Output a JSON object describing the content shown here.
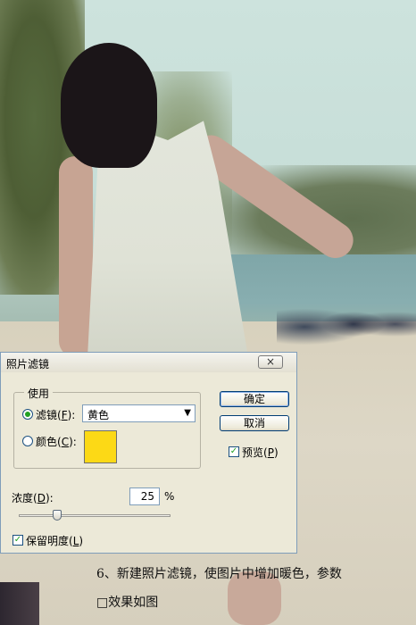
{
  "dialog": {
    "title": "照片滤镜",
    "close_symbol": "×",
    "use_group_label": "使用",
    "filter": {
      "prefix": "滤镜(",
      "key": "F",
      "suffix": "):",
      "selected": "黄色",
      "checked": true
    },
    "color": {
      "prefix": "颜色(",
      "key": "C",
      "suffix": "):",
      "checked": false,
      "swatch": "#fcd916"
    },
    "ok_label": "确定",
    "cancel_label": "取消",
    "preview": {
      "prefix": "预览(",
      "key": "P",
      "suffix": ")",
      "checked": true
    },
    "density": {
      "prefix": "浓度(",
      "key": "D",
      "suffix": "):",
      "value": "25",
      "unit": "%",
      "level_percent": 25
    },
    "preserve": {
      "prefix": "保留明度(",
      "key": "L",
      "suffix": ")",
      "checked": true
    }
  },
  "caption": {
    "line1": "6、新建照片滤镜，使图片中增加暖色，参数",
    "line2": "□效果如图"
  }
}
